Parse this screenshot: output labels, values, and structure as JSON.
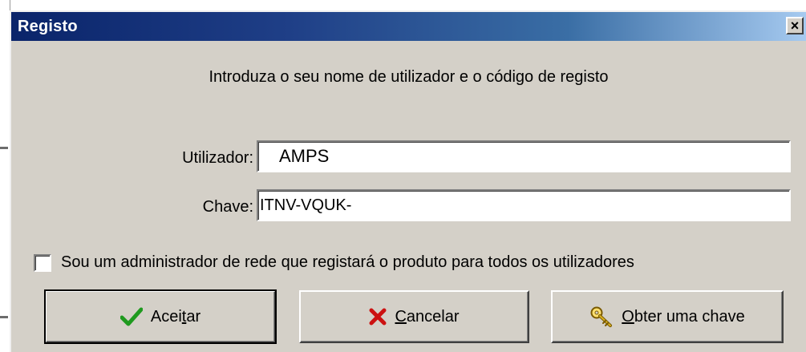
{
  "window": {
    "title": "Registo",
    "close_label": "×"
  },
  "instruction": "Introduza o seu nome de utilizador e o código de registo",
  "fields": {
    "user_label": "Utilizador:",
    "user_value": "AMPS",
    "key_label": "Chave:",
    "key_value": "ITNV-VQUK-"
  },
  "admin_checkbox": {
    "label": "Sou um administrador de rede que registará o produto para todos os utilizadores",
    "checked": false
  },
  "buttons": {
    "accept": {
      "pre": "Acei",
      "mnemonic": "t",
      "post": "ar",
      "icon": "checkmark-icon"
    },
    "cancel": {
      "pre": "",
      "mnemonic": "C",
      "post": "ancelar",
      "icon": "red-x-icon"
    },
    "get_key": {
      "pre": "",
      "mnemonic": "O",
      "post": "bter uma chave",
      "icon": "key-icon"
    }
  },
  "colors": {
    "title_bar_start": "#0a246a",
    "title_bar_end": "#a6caf0",
    "dialog_bg": "#d4d0c8",
    "check_green": "#1f9a1f",
    "cancel_red": "#cc1111",
    "key_gold": "#d8b020"
  }
}
